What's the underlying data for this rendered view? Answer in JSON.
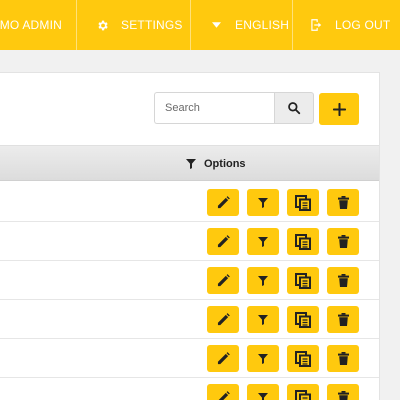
{
  "topbar": {
    "admin_label": "DEMO ADMIN",
    "settings_label": "SETTINGS",
    "language_label": "ENGLISH",
    "logout_label": "LOG OUT",
    "bg_color": "#ffc90e"
  },
  "toolbar": {
    "search_placeholder": "Search",
    "search_value": "",
    "add_label": "+"
  },
  "table": {
    "options_header": "Options",
    "row_count": 6,
    "row_actions": [
      "edit-icon",
      "filter-icon",
      "copy-icon",
      "delete-icon"
    ]
  }
}
